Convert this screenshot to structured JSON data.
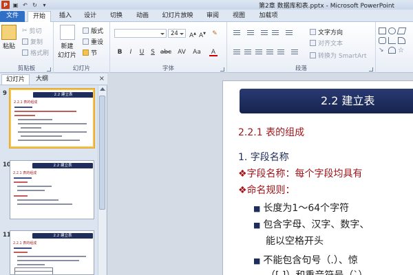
{
  "window": {
    "title": "第2章 数据库和表.pptx - Microsoft PowerPoint",
    "app_icon": "P"
  },
  "tabs": [
    "文件",
    "开始",
    "插入",
    "设计",
    "切换",
    "动画",
    "幻灯片放映",
    "审阅",
    "视图",
    "加载项"
  ],
  "ribbon": {
    "clipboard": {
      "label": "剪贴板",
      "paste": "粘贴",
      "cut": "剪切",
      "copy": "复制",
      "format_painter": "格式刷"
    },
    "slides": {
      "label": "幻灯片",
      "new_slide": "新建",
      "new_slide_2": "幻灯片",
      "layout": "版式",
      "reset": "重设",
      "section": "节"
    },
    "font": {
      "label": "字体",
      "font_name": "",
      "font_size": "24",
      "bold": "B",
      "italic": "I",
      "underline": "U",
      "strike": "S",
      "abc": "abc",
      "spacing": "AV",
      "case": "Aa",
      "color": "A"
    },
    "paragraph": {
      "label": "段落",
      "text_direction": "文字方向",
      "align_text": "对齐文本",
      "smartart": "转换为 SmartArt"
    },
    "drawing": {
      "label": ""
    }
  },
  "left_pane": {
    "tabs": [
      "幻灯片",
      "大纲"
    ],
    "close": "×",
    "thumbnails": [
      {
        "number": "9",
        "title": "2.2 建立表",
        "subtitle": "2.2.1  表的组成",
        "selected": true
      },
      {
        "number": "10",
        "title": "2.2 建立表",
        "subtitle": "2.2.1  表的组成",
        "selected": false
      },
      {
        "number": "11",
        "title": "2.2 建立表",
        "subtitle": "2.2.1  表的组成",
        "selected": false
      }
    ]
  },
  "slide": {
    "title": "2.2 建立表",
    "subtitle": "2.2.1  表的组成",
    "heading": "1. 字段名称",
    "lines": [
      {
        "marker": "❖",
        "text": "字段名称：每个字段均具有"
      },
      {
        "marker": "❖",
        "text": "命名规则："
      }
    ],
    "rules": [
      {
        "marker": "■",
        "text": "长度为1～64个字符"
      },
      {
        "marker": "■",
        "text": "包含字母、汉字、数字、"
      },
      {
        "marker": "",
        "text": "能以空格开头"
      },
      {
        "marker": "■",
        "text": "不能包含句号（.）、惊"
      },
      {
        "marker": "",
        "text": "（[ ]）和重音符号（`）"
      }
    ]
  },
  "colors": {
    "banner": "#1f2d5c",
    "accent_red": "#a0161b",
    "file_tab": "#2f6fc6",
    "selected_thumb": "#f2c14e"
  }
}
